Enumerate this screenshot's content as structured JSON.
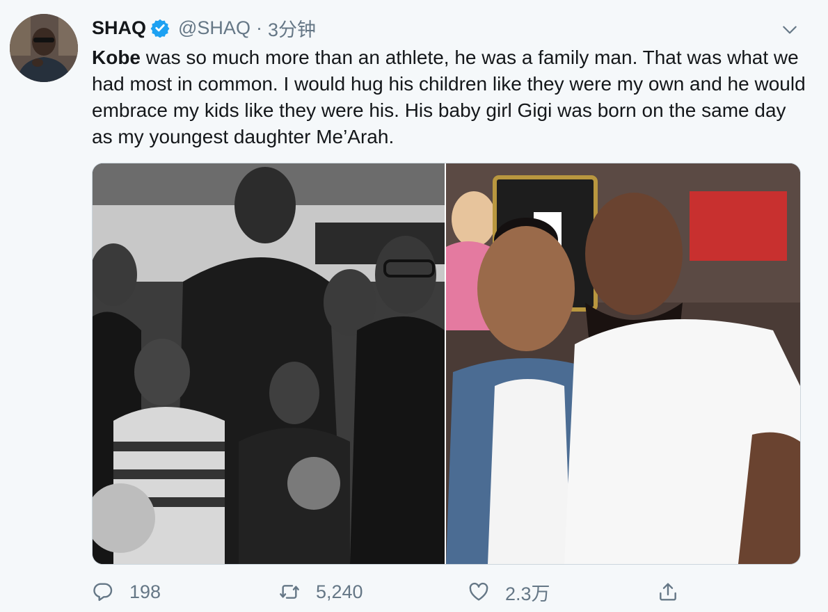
{
  "tweet": {
    "author_name": "SHAQ",
    "handle": "@SHAQ",
    "separator": "·",
    "time": "3分钟",
    "text_bold": "Kobe",
    "text_rest": " was so much more than an athlete, he was a family man. That was what we had most in common. I would hug his children like they were my own and he would embrace my kids like they were his. His baby girl Gigi was born on the same day as my youngest daughter Me’Arah."
  },
  "actions": {
    "reply_count": "198",
    "retweet_count": "5,240",
    "like_count": "2.3万"
  },
  "icons": {
    "verified": "verified-badge-icon",
    "menu": "chevron-down-icon",
    "reply": "reply-icon",
    "retweet": "retweet-icon",
    "like": "heart-icon",
    "share": "share-icon"
  },
  "colors": {
    "verified": "#1da1f2",
    "muted": "#657786",
    "text": "#14171a",
    "background": "#f5f8fa"
  }
}
